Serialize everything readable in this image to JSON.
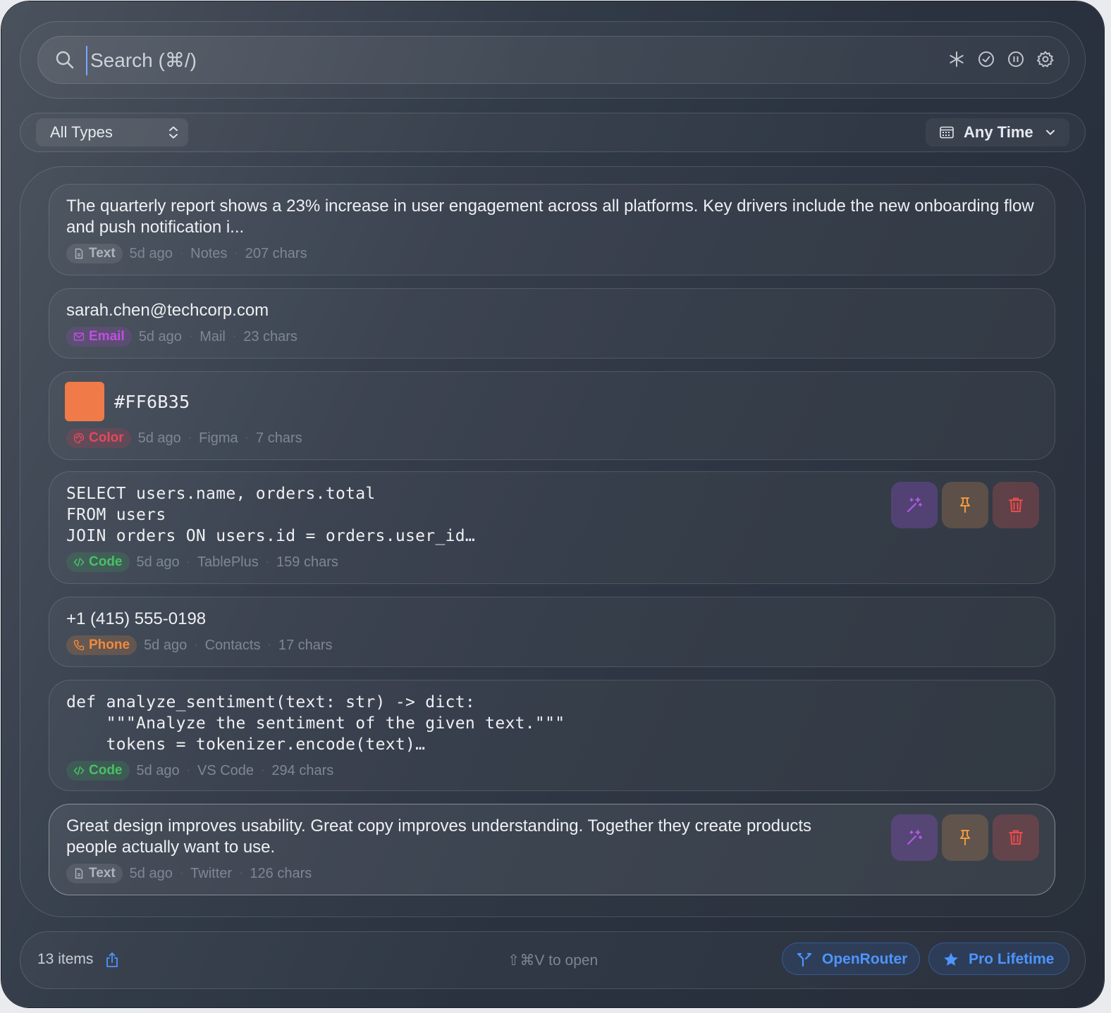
{
  "search": {
    "placeholder": "Search (⌘/)"
  },
  "toolbar": {
    "icons": [
      "asterisk-icon",
      "check-circle-icon",
      "pause-circle-icon",
      "gear-icon"
    ]
  },
  "filters": {
    "type_label": "All Types",
    "time_label": "Any Time"
  },
  "items": [
    {
      "type": "Text",
      "content": "The quarterly report shows a 23% increase in user engagement across all platforms. Key drivers include the new onboarding flow and push notification i...",
      "time": "5d ago",
      "source": "Notes",
      "chars": "207 chars"
    },
    {
      "type": "Email",
      "content": "sarah.chen@techcorp.com",
      "time": "5d ago",
      "source": "Mail",
      "chars": "23 chars"
    },
    {
      "type": "Color",
      "content": "#FF6B35",
      "swatch": "#f07a48",
      "time": "5d ago",
      "source": "Figma",
      "chars": "7 chars"
    },
    {
      "type": "Code",
      "content": "SELECT users.name, orders.total\nFROM users\nJOIN orders ON users.id = orders.user_id…",
      "time": "5d ago",
      "source": "TablePlus",
      "chars": "159 chars"
    },
    {
      "type": "Phone",
      "content": "+1 (415) 555-0198",
      "time": "5d ago",
      "source": "Contacts",
      "chars": "17 chars"
    },
    {
      "type": "Code",
      "content": "def analyze_sentiment(text: str) -> dict:\n    \"\"\"Analyze the sentiment of the given text.\"\"\"\n    tokens = tokenizer.encode(text)…",
      "time": "5d ago",
      "source": "VS Code",
      "chars": "294 chars"
    },
    {
      "type": "Text",
      "content": "Great design improves usability. Great copy improves understanding. Together they create products people actually want to use.",
      "time": "5d ago",
      "source": "Twitter",
      "chars": "126 chars"
    }
  ],
  "footer": {
    "count": "13 items",
    "hint": "⇧⌘V to open",
    "openrouter_label": "OpenRouter",
    "pro_label": "Pro Lifetime"
  },
  "colors": {
    "accent": "#4d95ff",
    "background": "#2f3745"
  }
}
